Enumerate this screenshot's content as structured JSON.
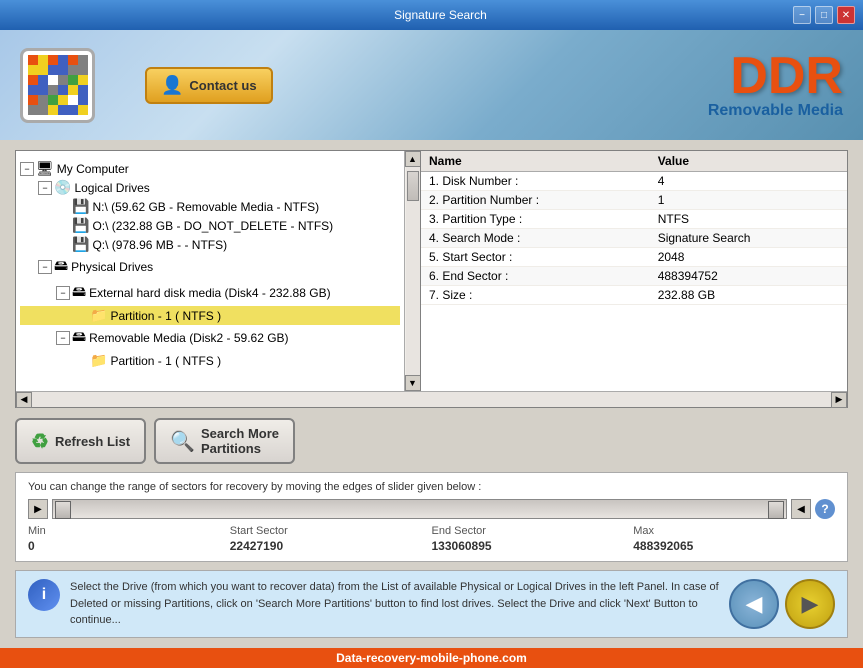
{
  "titlebar": {
    "title": "Signature Search",
    "minimize": "−",
    "maximize": "□",
    "close": "✕"
  },
  "header": {
    "contact_label": "Contact us",
    "brand_ddr": "DDR",
    "brand_sub": "Removable Media"
  },
  "tree": {
    "root": "My Computer",
    "items": [
      {
        "label": "My Computer",
        "level": 0,
        "expanded": true,
        "icon": "🖥"
      },
      {
        "label": "Logical Drives",
        "level": 1,
        "expanded": true,
        "icon": "💿"
      },
      {
        "label": "N:\\ (59.62 GB - Removable Media - NTFS)",
        "level": 2,
        "icon": "💾"
      },
      {
        "label": "O:\\ (232.88 GB - DO_NOT_DELETE - NTFS)",
        "level": 2,
        "icon": "💾"
      },
      {
        "label": "Q:\\ (978.96 MB -  - NTFS)",
        "level": 2,
        "icon": "💾"
      },
      {
        "label": "Physical Drives",
        "level": 1,
        "expanded": true,
        "icon": "🖴"
      },
      {
        "label": "External hard disk media (Disk4 - 232.88 GB)",
        "level": 2,
        "expanded": true,
        "icon": "🖴"
      },
      {
        "label": "Partition - 1 ( NTFS )",
        "level": 3,
        "icon": "📁",
        "selected": true
      },
      {
        "label": "Removable Media (Disk2 - 59.62 GB)",
        "level": 2,
        "expanded": true,
        "icon": "🖴"
      },
      {
        "label": "Partition - 1 ( NTFS )",
        "level": 3,
        "icon": "📁"
      }
    ]
  },
  "properties": {
    "headers": [
      "Name",
      "Value"
    ],
    "rows": [
      {
        "name": "1. Disk Number :",
        "value": "4"
      },
      {
        "name": "2. Partition Number :",
        "value": "1"
      },
      {
        "name": "3. Partition Type :",
        "value": "NTFS"
      },
      {
        "name": "4. Search Mode :",
        "value": "Signature Search"
      },
      {
        "name": "5. Start Sector :",
        "value": "2048"
      },
      {
        "name": "6. End Sector :",
        "value": "488394752"
      },
      {
        "name": "7. Size :",
        "value": "232.88 GB"
      }
    ]
  },
  "buttons": {
    "refresh": "Refresh List",
    "search_more": "Search More\nPartitions"
  },
  "sector": {
    "title": "You can change the range of sectors for recovery by moving the edges of slider given below :",
    "min_label": "Min",
    "min_val": "0",
    "start_label": "Start Sector",
    "start_val": "22427190",
    "end_label": "End Sector",
    "end_val": "133060895",
    "max_label": "Max",
    "max_val": "488392065"
  },
  "info": {
    "text": "Select the Drive (from which you want to recover data) from the List of available Physical or Logical Drives in the left Panel. In case of Deleted or missing Partitions, click on 'Search More Partitions' button to find lost drives. Select the Drive and click 'Next' Button to continue..."
  },
  "footer": {
    "text": "Data-recovery-mobile-phone.com"
  }
}
